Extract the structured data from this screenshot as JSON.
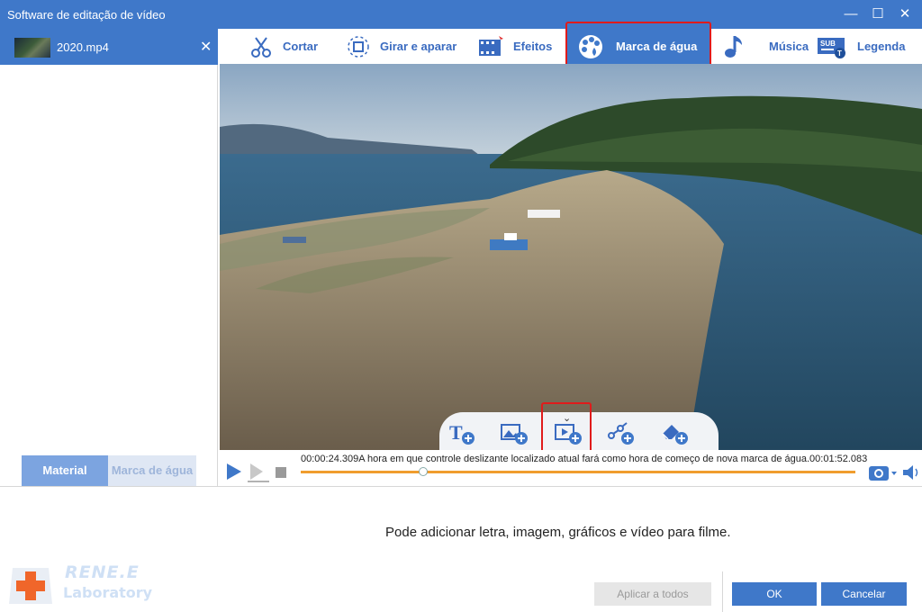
{
  "window": {
    "title": "Software de editação de vídeo",
    "minimize": "—",
    "maximize": "☐",
    "close": "✕"
  },
  "sidebar": {
    "file_name": "2020.mp4",
    "tabs": {
      "material": "Material",
      "watermark": "Marca de água"
    }
  },
  "tool_tabs": [
    {
      "label": "Cortar",
      "icon": "scissors-icon"
    },
    {
      "label": "Girar e aparar",
      "icon": "rotate-crop-icon"
    },
    {
      "label": "Efeitos",
      "icon": "effects-film-icon"
    },
    {
      "label": "Marca de água",
      "icon": "watermark-palette-icon",
      "active": true
    },
    {
      "label": "Música",
      "icon": "music-note-icon"
    },
    {
      "label": "Legenda",
      "icon": "subtitle-icon"
    }
  ],
  "watermark_tools": [
    {
      "icon": "add-text-icon"
    },
    {
      "icon": "add-image-icon"
    },
    {
      "icon": "add-video-icon"
    },
    {
      "icon": "add-graphic-icon"
    },
    {
      "icon": "add-eraser-icon"
    }
  ],
  "player": {
    "start_time": "00:00:24.309",
    "hint": "A hora em que controle deslizante localizado atual fará como hora de começo de nova marca de água.",
    "end_time": "00:01:52.083",
    "progress": 0.22
  },
  "bottom": {
    "hint": "Pode adicionar letra, imagem, gráficos e vídeo para filme.",
    "apply_all": "Aplicar a todos",
    "ok": "OK",
    "cancel": "Cancelar"
  },
  "logo": {
    "line1": "RENE.E",
    "line2": "Laboratory"
  },
  "colors": {
    "accent": "#3f78c9",
    "highlight_box": "#e01b1b",
    "timeline": "#f09d2e"
  }
}
